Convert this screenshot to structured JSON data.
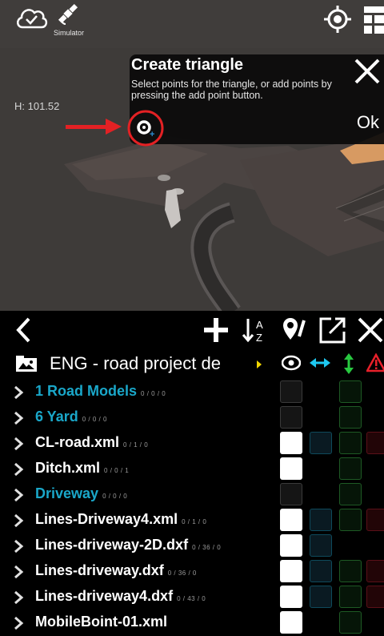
{
  "topbar": {
    "simulator_label": "Simulator",
    "icons": [
      "cloud-check-icon",
      "satellite-icon",
      "gps-target-icon",
      "layers-icon"
    ]
  },
  "view": {
    "height_label": "H: 101.52"
  },
  "dialog": {
    "title": "Create triangle",
    "message": "Select points for the triangle, or add points by pressing the add point button.",
    "ok_label": "Ok"
  },
  "toolbar": {
    "icons": [
      "back-icon",
      "add-icon",
      "sort-az-icon",
      "map-pin-edit-icon",
      "export-icon",
      "close-icon"
    ]
  },
  "project": {
    "name": "ENG - road project de",
    "columns": [
      "visibility-eye-icon",
      "horizontal-arrows-icon",
      "vertical-arrows-icon",
      "warning-icon"
    ]
  },
  "rows": [
    {
      "label": "1 Road Models",
      "count": "0 / 0 / 0",
      "color": "blue",
      "vis": "off",
      "blue": false,
      "green": true,
      "red": false
    },
    {
      "label": "6 Yard",
      "count": "0 / 0 / 0",
      "color": "blue",
      "vis": "off",
      "blue": false,
      "green": true,
      "red": false
    },
    {
      "label": "CL-road.xml",
      "count": "0 / 1 / 0",
      "color": "white",
      "vis": "on",
      "blue": true,
      "green": true,
      "red": true
    },
    {
      "label": "Ditch.xml",
      "count": "0 / 0 / 1",
      "color": "white",
      "vis": "on",
      "blue": false,
      "green": true,
      "red": false
    },
    {
      "label": "Driveway",
      "count": "0 / 0 / 0",
      "color": "blue",
      "vis": "off",
      "blue": false,
      "green": true,
      "red": false
    },
    {
      "label": "Lines-Driveway4.xml",
      "count": "0 / 1 / 0",
      "color": "white",
      "vis": "on",
      "blue": true,
      "green": true,
      "red": true
    },
    {
      "label": "Lines-driveway-2D.dxf",
      "count": "0 / 36 / 0",
      "color": "white",
      "vis": "on",
      "blue": true,
      "green": false,
      "red": false
    },
    {
      "label": "Lines-driveway.dxf",
      "count": "0 / 36 / 0",
      "color": "white",
      "vis": "on",
      "blue": true,
      "green": true,
      "red": true
    },
    {
      "label": "Lines-driveway4.dxf",
      "count": "0 / 43 / 0",
      "color": "white",
      "vis": "on",
      "blue": true,
      "green": true,
      "red": true
    },
    {
      "label": "MobileBoint-01.xml",
      "count": "",
      "color": "white",
      "vis": "on",
      "blue": false,
      "green": true,
      "red": false
    }
  ]
}
